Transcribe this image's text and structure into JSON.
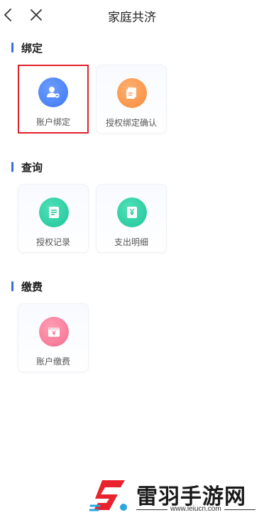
{
  "header": {
    "title": "家庭共济",
    "back_icon": "chevron-left-icon",
    "close_icon": "close-icon"
  },
  "sections": [
    {
      "title": "绑定",
      "items": [
        {
          "label": "账户绑定",
          "icon": "user-link-icon",
          "color": "#4a82f5",
          "selected": true
        },
        {
          "label": "授权绑定确认",
          "icon": "document-confirm-icon",
          "color": "#fb9a4f"
        }
      ]
    },
    {
      "title": "查询",
      "items": [
        {
          "label": "授权记录",
          "icon": "record-list-icon",
          "color": "#2fd1a8"
        },
        {
          "label": "支出明细",
          "icon": "expense-detail-icon",
          "color": "#2fd1a8"
        }
      ]
    },
    {
      "title": "缴费",
      "items": [
        {
          "label": "账户缴费",
          "icon": "payment-card-icon",
          "color": "#f77e9b"
        }
      ]
    }
  ],
  "watermark": {
    "name": "雷羽手游网",
    "url": "www.leiucn.com"
  },
  "colors": {
    "accent": "#3b6fe0",
    "highlight_border": "#e0202a"
  }
}
